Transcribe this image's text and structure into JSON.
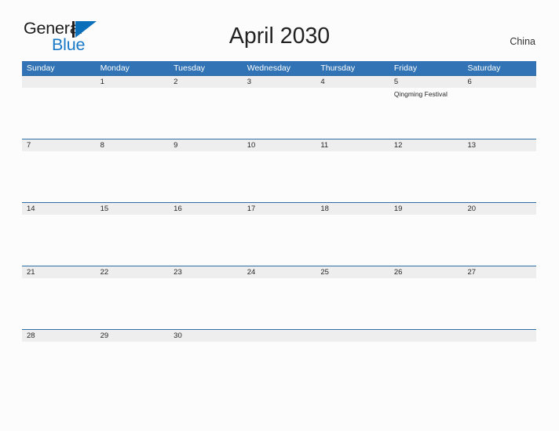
{
  "brand": {
    "line1": "General",
    "line2": "Blue",
    "mark_icon": "triangle-logo-icon",
    "colors": {
      "bar": "#231f20",
      "triangle": "#0b6fba",
      "line1_text": "#1c1c1c",
      "line2_text": "#1878c8"
    }
  },
  "header": {
    "title": "April 2030",
    "locale": "China"
  },
  "theme": {
    "header_blue": "#3173b4",
    "row_border_blue": "#2e6da4",
    "band_gray": "#eeeeee",
    "page_background": "#fcfcfc",
    "text": "#262626"
  },
  "calendar": {
    "weekdays": [
      "Sunday",
      "Monday",
      "Tuesday",
      "Wednesday",
      "Thursday",
      "Friday",
      "Saturday"
    ],
    "weeks": [
      [
        {
          "day": "",
          "events": []
        },
        {
          "day": "1",
          "events": []
        },
        {
          "day": "2",
          "events": []
        },
        {
          "day": "3",
          "events": []
        },
        {
          "day": "4",
          "events": []
        },
        {
          "day": "5",
          "events": [
            "Qingming Festival"
          ]
        },
        {
          "day": "6",
          "events": []
        }
      ],
      [
        {
          "day": "7",
          "events": []
        },
        {
          "day": "8",
          "events": []
        },
        {
          "day": "9",
          "events": []
        },
        {
          "day": "10",
          "events": []
        },
        {
          "day": "11",
          "events": []
        },
        {
          "day": "12",
          "events": []
        },
        {
          "day": "13",
          "events": []
        }
      ],
      [
        {
          "day": "14",
          "events": []
        },
        {
          "day": "15",
          "events": []
        },
        {
          "day": "16",
          "events": []
        },
        {
          "day": "17",
          "events": []
        },
        {
          "day": "18",
          "events": []
        },
        {
          "day": "19",
          "events": []
        },
        {
          "day": "20",
          "events": []
        }
      ],
      [
        {
          "day": "21",
          "events": []
        },
        {
          "day": "22",
          "events": []
        },
        {
          "day": "23",
          "events": []
        },
        {
          "day": "24",
          "events": []
        },
        {
          "day": "25",
          "events": []
        },
        {
          "day": "26",
          "events": []
        },
        {
          "day": "27",
          "events": []
        }
      ],
      [
        {
          "day": "28",
          "events": []
        },
        {
          "day": "29",
          "events": []
        },
        {
          "day": "30",
          "events": []
        },
        {
          "day": "",
          "events": []
        },
        {
          "day": "",
          "events": []
        },
        {
          "day": "",
          "events": []
        },
        {
          "day": "",
          "events": []
        }
      ]
    ]
  }
}
